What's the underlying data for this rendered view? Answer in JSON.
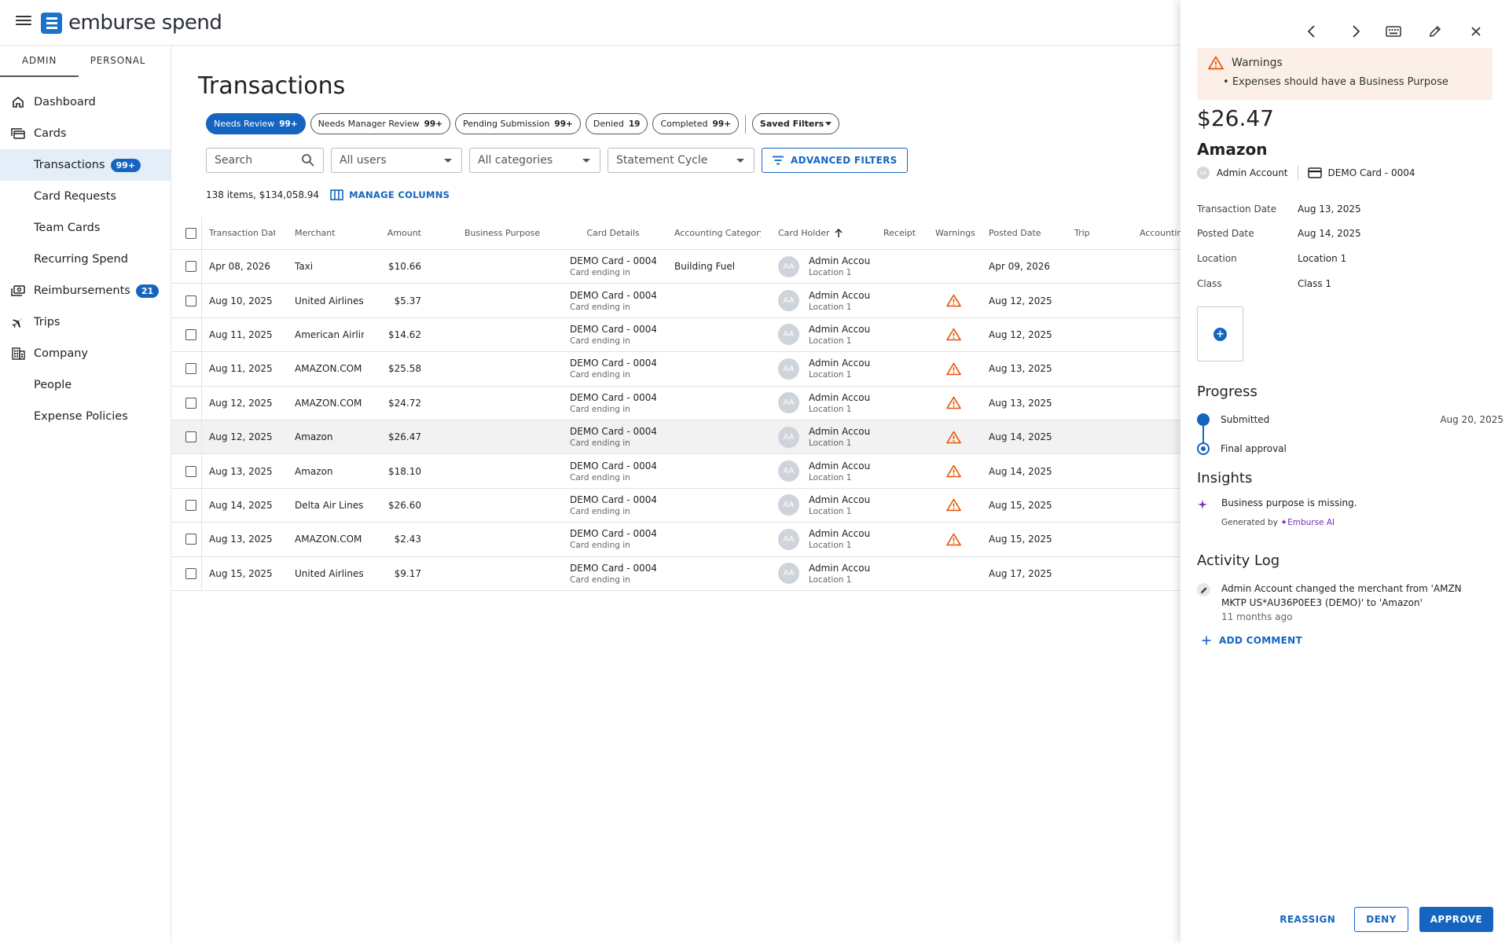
{
  "app": {
    "logo_text": "emburse spend"
  },
  "sidebar": {
    "tabs": [
      "ADMIN",
      "PERSONAL"
    ],
    "items": [
      {
        "label": "Dashboard",
        "icon": "home-icon"
      },
      {
        "label": "Cards",
        "icon": "cards-icon"
      },
      {
        "label": "Transactions",
        "badge": "99+"
      },
      {
        "label": "Card Requests"
      },
      {
        "label": "Team Cards"
      },
      {
        "label": "Recurring Spend"
      },
      {
        "label": "Reimbursements",
        "icon": "reimbursements-icon",
        "badge": "21"
      },
      {
        "label": "Trips",
        "icon": "airplane-icon"
      },
      {
        "label": "Company",
        "icon": "building-icon"
      },
      {
        "label": "People"
      },
      {
        "label": "Expense Policies"
      }
    ]
  },
  "main": {
    "title": "Transactions",
    "chips": [
      {
        "label": "Needs Review",
        "count": "99+"
      },
      {
        "label": "Needs Manager Review",
        "count": "99+"
      },
      {
        "label": "Pending Submission",
        "count": "99+"
      },
      {
        "label": "Denied",
        "count": "19"
      },
      {
        "label": "Completed",
        "count": "99+"
      }
    ],
    "saved_filters": "Saved Filters",
    "filters": {
      "search_placeholder": "Search",
      "users": "All users",
      "categories": "All categories",
      "cycle": "Statement Cycle",
      "advanced": "ADVANCED FILTERS"
    },
    "summary": "138 items, $134,058.94",
    "manage_columns": "MANAGE COLUMNS",
    "columns": {
      "date": "Transaction Date",
      "merchant": "Merchant",
      "amount": "Amount",
      "bp": "Business Purpose",
      "card": "Card Details",
      "category": "Accounting Category",
      "holder": "Card Holder",
      "receipt": "Receipt",
      "warnings": "Warnings",
      "posted": "Posted Date",
      "trip": "Trip",
      "accounting": "Accountin"
    },
    "rows": [
      {
        "date": "Apr 08, 2026",
        "merchant": "Taxi",
        "amount": "$10.66",
        "card": "DEMO Card - 0004",
        "card_sub": "Card ending in",
        "category": "Building Fuel",
        "av": "AA",
        "holder": "Admin Accour",
        "loc": "Location 1",
        "posted": "Apr 09, 2026",
        "warn": false
      },
      {
        "date": "Aug 10, 2025",
        "merchant": "United Airlines",
        "amount": "$5.37",
        "card": "DEMO Card - 0004",
        "card_sub": "Card ending in",
        "category": "",
        "av": "AA",
        "holder": "Admin Accour",
        "loc": "Location 1",
        "posted": "Aug 12, 2025",
        "warn": true
      },
      {
        "date": "Aug 11, 2025",
        "merchant": "American Airlines",
        "amount": "$14.62",
        "card": "DEMO Card - 0004",
        "card_sub": "Card ending in",
        "category": "",
        "av": "AA",
        "holder": "Admin Accour",
        "loc": "Location 1",
        "posted": "Aug 12, 2025",
        "warn": true
      },
      {
        "date": "Aug 11, 2025",
        "merchant": "AMAZON.COM",
        "amount": "$25.58",
        "card": "DEMO Card - 0004",
        "card_sub": "Card ending in",
        "category": "",
        "av": "AA",
        "holder": "Admin Accour",
        "loc": "Location 1",
        "posted": "Aug 13, 2025",
        "warn": true
      },
      {
        "date": "Aug 12, 2025",
        "merchant": "AMAZON.COM /",
        "amount": "$24.72",
        "card": "DEMO Card - 0004",
        "card_sub": "Card ending in",
        "category": "",
        "av": "AA",
        "holder": "Admin Accour",
        "loc": "Location 1",
        "posted": "Aug 13, 2025",
        "warn": true
      },
      {
        "date": "Aug 12, 2025",
        "merchant": "Amazon",
        "amount": "$26.47",
        "card": "DEMO Card - 0004",
        "card_sub": "Card ending in",
        "category": "",
        "av": "AA",
        "holder": "Admin Accour",
        "loc": "Location 1",
        "posted": "Aug 14, 2025",
        "warn": true
      },
      {
        "date": "Aug 13, 2025",
        "merchant": "Amazon",
        "amount": "$18.10",
        "card": "DEMO Card - 0004",
        "card_sub": "Card ending in",
        "category": "",
        "av": "AA",
        "holder": "Admin Accour",
        "loc": "Location 1",
        "posted": "Aug 14, 2025",
        "warn": true
      },
      {
        "date": "Aug 14, 2025",
        "merchant": "Delta Air Lines",
        "amount": "$26.60",
        "card": "DEMO Card - 0004",
        "card_sub": "Card ending in",
        "category": "",
        "av": "AA",
        "holder": "Admin Accour",
        "loc": "Location 1",
        "posted": "Aug 15, 2025",
        "warn": true
      },
      {
        "date": "Aug 13, 2025",
        "merchant": "AMAZON.COM",
        "amount": "$2.43",
        "card": "DEMO Card - 0004",
        "card_sub": "Card ending in",
        "category": "",
        "av": "AA",
        "holder": "Admin Accour",
        "loc": "Location 1",
        "posted": "Aug 15, 2025",
        "warn": true
      },
      {
        "date": "Aug 15, 2025",
        "merchant": "United Airlines",
        "amount": "$9.17",
        "card": "DEMO Card - 0004",
        "card_sub": "Card ending in",
        "category": "",
        "av": "AA",
        "holder": "Admin Accour",
        "loc": "Location 1",
        "posted": "Aug 17, 2025",
        "warn": false
      }
    ]
  },
  "panel": {
    "warnings_title": "Warnings",
    "warning_item": "Expenses should have a Business Purpose",
    "amount": "$26.47",
    "merchant": "Amazon",
    "account": "Admin Account",
    "account_av": "AA",
    "card": "DEMO Card - 0004",
    "fields": [
      {
        "k": "Transaction Date",
        "v": "Aug 13, 2025"
      },
      {
        "k": "Posted Date",
        "v": "Aug 14, 2025"
      },
      {
        "k": "Location",
        "v": "Location 1"
      },
      {
        "k": "Class",
        "v": "Class 1"
      }
    ],
    "progress_title": "Progress",
    "progress": {
      "step1": "Submitted",
      "step1_date": "Aug 20, 2025",
      "step2": "Final approval"
    },
    "insights_title": "Insights",
    "insight_text": "Business purpose is missing.",
    "generated_by": "Generated by",
    "ai_name": "Emburse AI",
    "activity_title": "Activity Log",
    "activity_text": "Admin Account changed the merchant from 'AMZN MKTP US*AU36P0EE3 (DEMO)' to 'Amazon'",
    "activity_when": "11 months ago",
    "add_comment": "ADD COMMENT",
    "reassign": "REASSIGN",
    "deny": "DENY",
    "approve": "APPROVE"
  },
  "colors": {
    "accent": "#1565c0",
    "warning": "#e65100",
    "warn_bg": "#fcefe8",
    "ai": "#7b2fb0"
  }
}
